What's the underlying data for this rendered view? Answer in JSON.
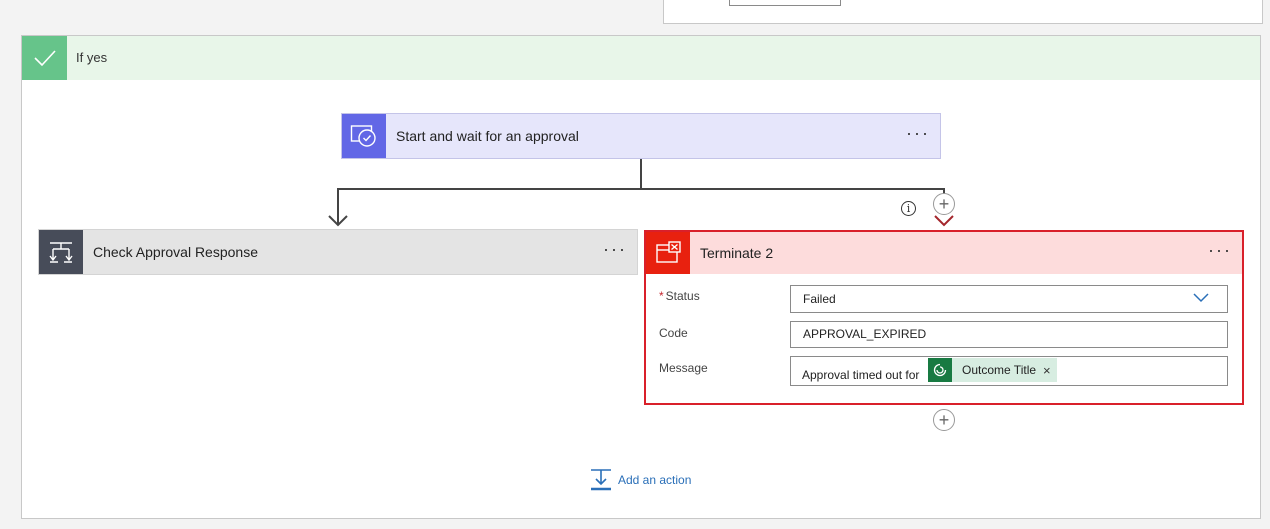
{
  "scope": {
    "title": "If yes"
  },
  "approval_action": {
    "title": "Start and wait for an approval",
    "menu_label": "···"
  },
  "check_action": {
    "title": "Check Approval Response",
    "menu_label": "···"
  },
  "terminate_action": {
    "title": "Terminate 2",
    "menu_label": "···",
    "fields": {
      "status": {
        "required_mark": "*",
        "label": "Status",
        "value": "Failed"
      },
      "code": {
        "label": "Code",
        "value": "APPROVAL_EXPIRED"
      },
      "message": {
        "label": "Message",
        "prefix_text": "Approval timed out for",
        "token": {
          "label": "Outcome Title",
          "remove": "×"
        }
      }
    }
  },
  "connectors": {
    "plus_symbol": "+",
    "info_symbol": "i"
  },
  "add_action": {
    "label": "Add an action"
  },
  "colors": {
    "success": "#66c48a",
    "approval": "#6267e6",
    "control": "#474c59",
    "terminate": "#e8210f",
    "terminate_border": "#d9202a",
    "link": "#2a6fb8",
    "token": "#187a42"
  }
}
